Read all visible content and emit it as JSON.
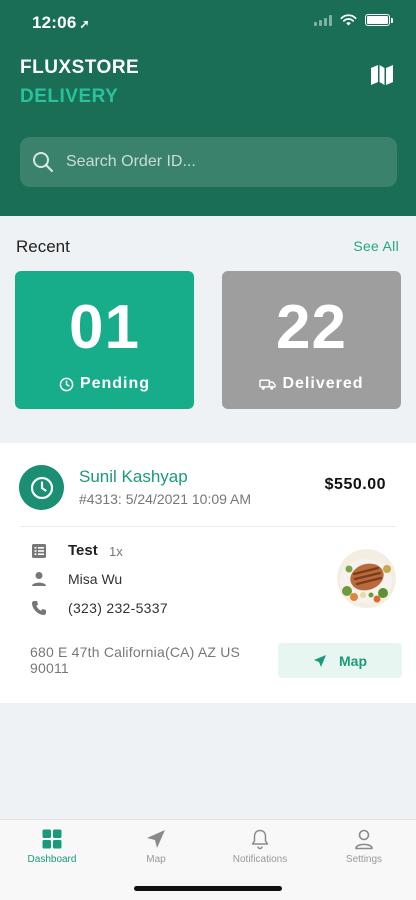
{
  "status_bar": {
    "time": "12:06",
    "location_glyph": "➚"
  },
  "brand": {
    "name": "FLUXSTORE",
    "subtitle": "DELIVERY"
  },
  "search": {
    "placeholder": "Search Order ID..."
  },
  "recent": {
    "title": "Recent",
    "see_all": "See All",
    "pending": {
      "count": "01",
      "label": "Pending"
    },
    "delivered": {
      "count": "22",
      "label": "Delivered"
    }
  },
  "order": {
    "customer": "Sunil Kashyap",
    "meta": "#4313: 5/24/2021 10:09 AM",
    "total": "$550.00",
    "item_name": "Test",
    "item_qty": "1x",
    "receiver": "Misa Wu",
    "phone": "(323) 232-5337",
    "address": "680 E 47th California(CA) AZ US 90011",
    "map_label": "Map"
  },
  "nav": {
    "dashboard": "Dashboard",
    "map": "Map",
    "notifications": "Notifications",
    "settings": "Settings"
  },
  "colors": {
    "header": "#1b6e56",
    "accent": "#17ad8a",
    "delivered": "#9e9e9e"
  },
  "icons": [
    "map-icon",
    "search-icon",
    "clock-icon",
    "truck-icon",
    "list-icon",
    "person-icon",
    "phone-icon",
    "navigation-arrow-icon",
    "dashboard-icon",
    "bell-icon",
    "user-icon"
  ]
}
